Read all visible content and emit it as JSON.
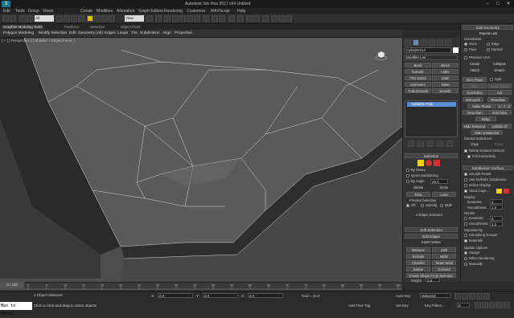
{
  "window": {
    "title": "Autodesk 3ds Max 2017  x64   Untitled",
    "app_icon": "3ds-max-logo",
    "logo_text": "3",
    "minimize": "–",
    "maximize": "□",
    "close": "✕"
  },
  "menu": [
    "Edit",
    "Tools",
    "Group",
    "Views",
    "Create",
    "Modifiers",
    "Animation",
    "Graph Editors",
    "Rendering",
    "Customize",
    "MAXScript",
    "Help"
  ],
  "toolbar": {
    "selection_filter": "All",
    "view_select": "View"
  },
  "ribbon": {
    "tabs": [
      "Graphite Modeling Tools",
      "Freeform",
      "Selection",
      "Object Paint"
    ],
    "items": [
      "Polygon Modeling",
      "Modify Selection",
      "Edit",
      "Geometry (All)",
      "Edges",
      "Loops",
      "Tris",
      "Subdivision",
      "Align",
      "Properties"
    ]
  },
  "viewport": {
    "label": "[ + ] [ Perspective ] [ Shaded + Edged Faces ]",
    "background": "#4d4d4d"
  },
  "command_panel": {
    "object_name": "Cylinder014",
    "modifier_list": "Modifier List",
    "buttons": [
      "Bend",
      "Mirror",
      "Extrude",
      "Lathe",
      "FFD 3x3x3",
      "Shell",
      "Symmetry",
      "Taper",
      "TurboSmooth",
      "Smooth"
    ],
    "stack_item": "Editable Poly",
    "selection_title": "Selection",
    "by_vertex": "By Vertex",
    "ignore_backfacing": "Ignore Backfacing",
    "by_angle": "By Angle",
    "angle_value": "45.0",
    "shrink": "Shrink",
    "grow": "Grow",
    "ring": "Ring",
    "loop": "Loop",
    "preview_selection": "Preview Selection",
    "preview_off": "Off",
    "preview_subobj": "SubObj",
    "preview_multi": "Multi",
    "selected_count": "2 Edges Selected",
    "soft_selection": "Soft Selection",
    "edit_edges": "Edit Edges",
    "insert_vertex": "Insert Vertex",
    "remove": "Remove",
    "split": "Split",
    "extrude": "Extrude",
    "weld": "Weld",
    "chamfer": "Chamfer",
    "target_weld": "Target Weld",
    "bridge": "Bridge",
    "connect": "Connect",
    "create_shape": "Create Shape From Selection",
    "weight_label": "Weight",
    "weight_value": "1.0",
    "crease_label": "Crease",
    "crease_value": "0.0"
  },
  "edit_geometry": {
    "title": "Edit Geometry",
    "repeat_last": "Repeat Last",
    "constraints": "Constraints",
    "none": "None",
    "edge": "Edge",
    "face": "Face",
    "normal": "Normal",
    "preserve_uvs": "Preserve UVs",
    "create": "Create",
    "collapse": "Collapse",
    "attach": "Attach",
    "detach": "Detach",
    "slice_plane": "Slice Plane",
    "split": "Split",
    "slice": "Slice",
    "reset_plane": "Reset Plane",
    "quickslice": "QuickSlice",
    "cut": "Cut",
    "msmooth": "MSmooth",
    "tessellate": "Tessellate",
    "make_planar": "Make Planar",
    "x": "X",
    "y": "Y",
    "z": "Z",
    "view_align": "View Align",
    "grid_align": "Grid Align",
    "relax": "Relax",
    "hide_selected": "Hide Selected",
    "unhide_all": "Unhide All",
    "hide_unselected": "Hide Unselected",
    "named_selections": "Named Selections:",
    "copy": "Copy",
    "paste": "Paste",
    "delete_isolated": "Delete Isolated Vertices",
    "full_interactivity": "Full Interactivity"
  },
  "subdivision_surface": {
    "title": "Subdivision Surface",
    "smooth_result": "Smooth Result",
    "use_nurms": "Use NURMS Subdivision",
    "isoline_display": "Isoline Display",
    "show_cage": "Show Cage......",
    "display": "Display",
    "iterations_label": "Iterations:",
    "iterations_value": "1",
    "smoothness_label": "Smoothness:",
    "smoothness_value": "1.0",
    "render": "Render",
    "r_iterations_value": "0",
    "r_smoothness_value": "1.0",
    "separate_by": "Separate By",
    "smoothing_groups": "Smoothing Groups",
    "materials": "Materials",
    "update_options": "Update Options",
    "always": "Always",
    "when_rendering": "When Rendering",
    "manually": "Manually"
  },
  "timeline": {
    "slider": "0 / 100",
    "ticks": [
      "0",
      "5",
      "10",
      "15",
      "20",
      "25",
      "30",
      "35",
      "40",
      "45",
      "50",
      "55",
      "60",
      "65",
      "70",
      "75",
      "80",
      "85",
      "90",
      "95",
      "100"
    ]
  },
  "status": {
    "maxscript": "Max to Physc.",
    "selected": "1 Object Selected",
    "prompt": "Click or click-and-drag to select objects",
    "x_label": "X:",
    "x_value": "0.0",
    "y_label": "Y:",
    "y_value": "0.0",
    "z_label": "Z:",
    "z_value": "0.0",
    "grid": "Grid = 10.0",
    "auto_key": "Auto Key",
    "auto_key_value": "Selected",
    "set_key": "Set Key",
    "key_filters": "Key Filters...",
    "add_time_tag": "Add Time Tag",
    "frame": "0"
  },
  "colors": {
    "accent_yellow": "#e0c000",
    "swatch_yellow": "#f0d400",
    "swatch_red": "#d03030",
    "selection_blue": "#5b8ccf"
  }
}
